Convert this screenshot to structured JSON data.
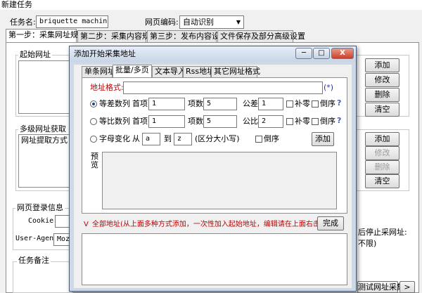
{
  "window": {
    "title": "新建任务"
  },
  "form": {
    "task_name_label": "任务名:",
    "task_name_value": "briquette machine",
    "encoding_label": "网页编码:",
    "encoding_value": "自动识别"
  },
  "main_tabs": [
    "第一步：采集网址规则",
    "第二步：采集内容规则",
    "第三步：发布内容设置",
    "文件保存及部分高级设置"
  ],
  "start_url": {
    "label": "起始网址",
    "buttons": [
      "添加",
      "修改",
      "删除",
      "清空"
    ]
  },
  "multi_url": {
    "label": "多级网址获取（地",
    "item": "网址提取方式",
    "buttons": [
      "添加",
      "修改",
      "删除",
      "清空"
    ]
  },
  "login": {
    "label": "网页登录信息",
    "cookie_label": "Cookie",
    "user_agent_label": "User-Agent",
    "user_agent_value": "Mozil"
  },
  "right_side": {
    "text1": "后停止采网址:",
    "text2": "不限)",
    "button": "测试网址采集",
    "gt": ">"
  },
  "notes": {
    "label": "任务备注"
  },
  "dialog": {
    "title": "添加开始采集地址",
    "min_label": "─",
    "max_label": "□",
    "close_label": "X",
    "tabs": [
      "单条网址",
      "批量/多页",
      "文本导入",
      "Rss地址",
      "其它网址格式"
    ],
    "url_format_label": "地址格式:",
    "url_format_value": "",
    "wildcard": "(*)",
    "arith": {
      "label": "等差数列",
      "first_label": "首项",
      "first_value": "1",
      "count_label": "项数",
      "count_value": "5",
      "diff_label": "公差",
      "diff_value": "1",
      "pad_label": "补零",
      "rev_label": "倒序",
      "selected": true
    },
    "geo": {
      "label": "等比数列",
      "first_label": "首项",
      "first_value": "1",
      "count_label": "项数",
      "count_value": "5",
      "ratio_label": "公比",
      "ratio_value": "2",
      "pad_label": "补零",
      "rev_label": "倒序",
      "selected": false
    },
    "letters": {
      "label": "字母变化",
      "from_label": "从",
      "from_value": "a",
      "to_label": "到",
      "to_value": "z",
      "case_note": "(区分大小写)",
      "rev_label": "倒序",
      "add_button": "添加",
      "selected": false
    },
    "help_glyph": "?",
    "preview_label": "预览",
    "all_urls_text": "全部地址(从上面多种方式添加，一次性加入起始地址，编辑请在上面右击)",
    "chevron": "V",
    "done_button": "完成"
  }
}
